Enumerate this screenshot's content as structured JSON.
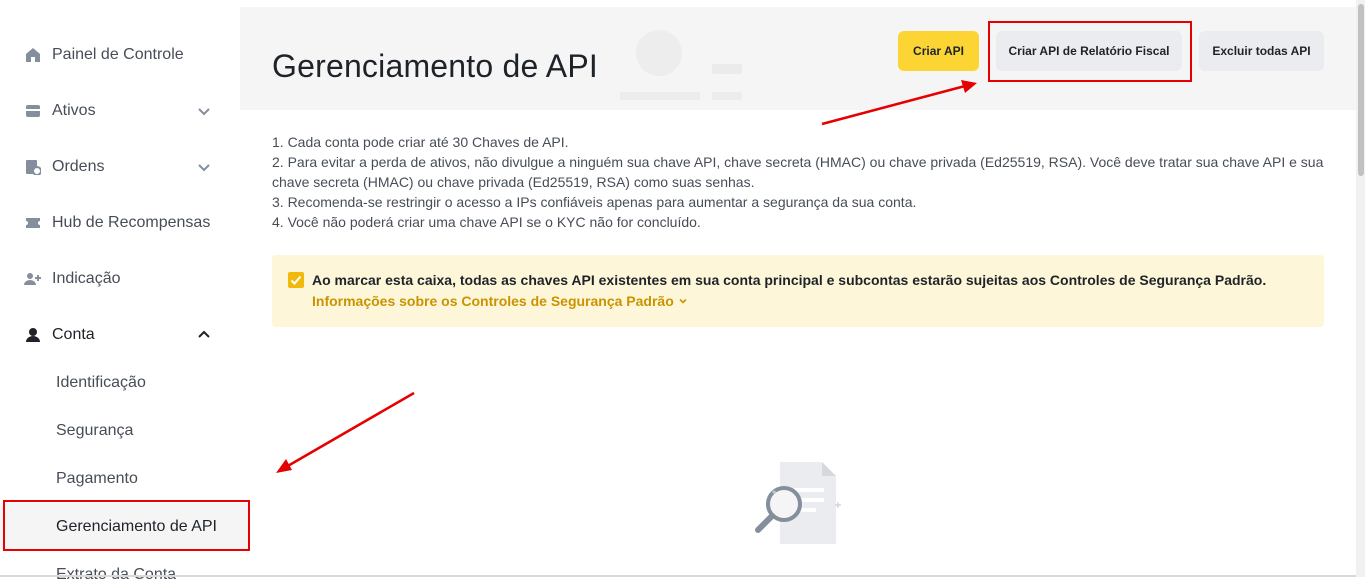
{
  "sidebar": {
    "items": [
      {
        "label": "Painel de Controle",
        "icon": "home-icon"
      },
      {
        "label": "Ativos",
        "icon": "wallet-icon"
      },
      {
        "label": "Ordens",
        "icon": "orders-icon"
      },
      {
        "label": "Hub de Recompensas",
        "icon": "ticket-icon"
      },
      {
        "label": "Indicação",
        "icon": "add-user-icon"
      },
      {
        "label": "Conta",
        "icon": "user-icon"
      }
    ],
    "account_subitems": [
      {
        "label": "Identificação"
      },
      {
        "label": "Segurança"
      },
      {
        "label": "Pagamento"
      },
      {
        "label": "Gerenciamento de API"
      },
      {
        "label": "Extrato da Conta"
      }
    ]
  },
  "header": {
    "title": "Gerenciamento de API",
    "buttons": {
      "create": "Criar API",
      "fiscal": "Criar API de Relatório Fiscal",
      "delete_all": "Excluir todas API"
    }
  },
  "instructions": [
    "1. Cada conta pode criar até 30 Chaves de API.",
    "2. Para evitar a perda de ativos, não divulgue a ninguém sua chave API, chave secreta (HMAC) ou chave privada (Ed25519, RSA). Você deve tratar sua chave API e sua chave secreta (HMAC) ou chave privada (Ed25519, RSA) como suas senhas.",
    "3. Recomenda-se restringir o acesso a IPs confiáveis apenas para aumentar a segurança da sua conta.",
    "4. Você não poderá criar uma chave API se o KYC não for concluído."
  ],
  "notice": {
    "checked": true,
    "text": "Ao marcar esta caixa, todas as chaves API existentes em sua conta principal e subcontas estarão sujeitas aos Controles de Segurança Padrão.",
    "link": "Informações sobre os Controles de Segurança Padrão"
  },
  "colors": {
    "accent": "#fcd535",
    "link": "#c99400",
    "annotation": "#e60000"
  }
}
